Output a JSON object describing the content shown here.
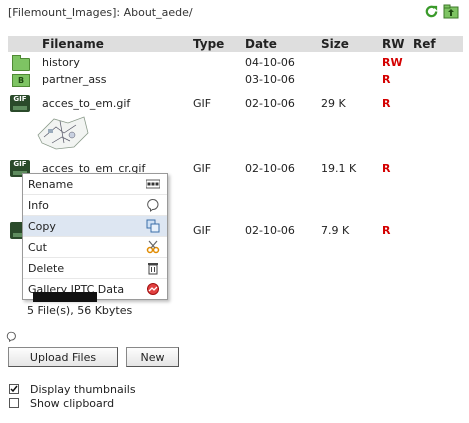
{
  "path": "[Filemount_Images]: About_aede/",
  "top_icons": [
    "refresh-icon",
    "folder-up-icon"
  ],
  "columns": {
    "filename": "Filename",
    "type": "Type",
    "date": "Date",
    "size": "Size",
    "rw": "RW",
    "ref": "Ref"
  },
  "folders": [
    {
      "name": "history",
      "date": "04-10-06",
      "rw": "RW"
    },
    {
      "name": "partner_ass",
      "date": "03-10-06",
      "rw": "R"
    }
  ],
  "files": [
    {
      "icon": "GIF",
      "name": "acces_to_em.gif",
      "type": "GIF",
      "date": "02-10-06",
      "size": "29 K",
      "rw": "R"
    },
    {
      "icon": "GIF",
      "name": "acces_to_em_cr.gif",
      "type": "GIF",
      "date": "02-10-06",
      "size": "19.1 K",
      "rw": "R"
    },
    {
      "icon": "",
      "name": "",
      "type": "GIF",
      "date": "02-10-06",
      "size": "7.9 K",
      "rw": "R"
    }
  ],
  "context_menu": [
    {
      "label": "Rename",
      "icon": "rename-icon"
    },
    {
      "label": "Info",
      "icon": "info-icon"
    },
    {
      "label": "Copy",
      "icon": "copy-icon"
    },
    {
      "label": "Cut",
      "icon": "scissors-icon"
    },
    {
      "label": "Delete",
      "icon": "trash-icon"
    },
    {
      "label": "Gallery IPTC Data",
      "icon": "gallery-icon"
    }
  ],
  "summary": "5 File(s), 56 Kbytes",
  "buttons": {
    "upload": "Upload Files",
    "new": "New"
  },
  "options": {
    "display_thumbnails": {
      "label": "Display thumbnails",
      "checked": true
    },
    "show_clipboard": {
      "label": "Show clipboard",
      "checked": false
    }
  },
  "colors": {
    "rw_red": "#d40000",
    "header_bg": "#dedede",
    "menu_highlight": "#dde6f2",
    "folder_green": "#7ec463"
  }
}
